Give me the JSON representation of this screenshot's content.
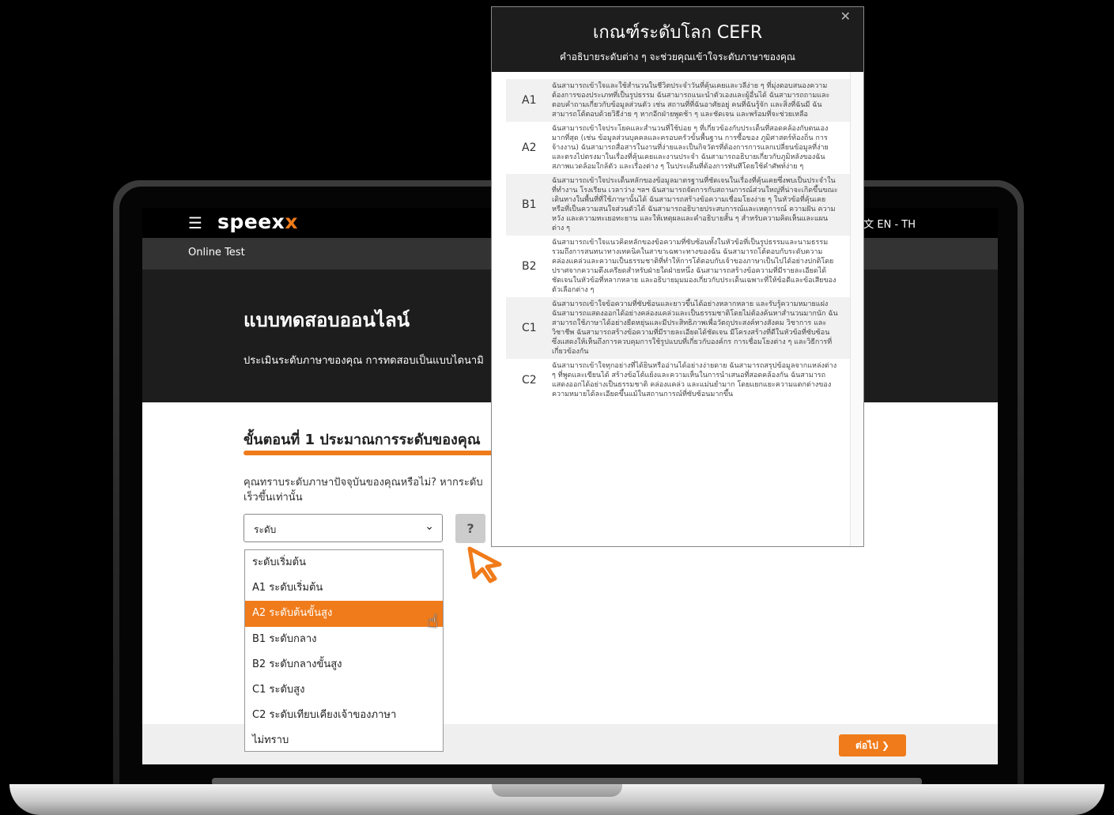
{
  "app": {
    "logo_main": "speex",
    "logo_accent": "x",
    "language": "EN - TH",
    "menu_icon": "hamburger-icon",
    "breadcrumb": "Online Test"
  },
  "hero": {
    "title": "แบบทดสอบออนไลน์",
    "subtitle": "ประเมินระดับภาษาของคุณ การทดสอบเป็นแบบไดนามิ"
  },
  "step": {
    "title": "ขั้นตอนที่ 1 ประมาณการระดับของคุณ",
    "question": "คุณทราบระดับภาษาปัจจุบันของคุณหรือไม่? หากระดับ เร็วขึ้นเท่านั้น"
  },
  "level_select": {
    "value": "ระดับ",
    "help_label": "?",
    "options": [
      "ระดับเริ่มต้น",
      "A1 ระดับเริ่มต้น",
      "A2 ระดับต้นขั้นสูง",
      "B1 ระดับกลาง",
      "B2 ระดับกลางขั้นสูง",
      "C1 ระดับสูง",
      "C2 ระดับเทียบเคียงเจ้าของภาษา",
      "ไม่ทราบ"
    ],
    "highlighted_index": 2
  },
  "footer": {
    "next_label": "ต่อไป ❯"
  },
  "cefr_modal": {
    "title": "เกณฑ์ระดับโลก CEFR",
    "subtitle": "คำอธิบายระดับต่าง ๆ จะช่วยคุณเข้าใจระดับภาษาของคุณ",
    "close_label": "✕",
    "levels": [
      {
        "code": "A1",
        "desc": "ฉันสามารถเข้าใจและใช้สำนวนในชีวิตประจำวันที่คุ้นเคยและวลีง่าย ๆ ที่มุ่งตอบสนองความต้องการของประเภทที่เป็นรูปธรรม ฉันสามารถแนะนำตัวเองและผู้อื่นได้ ฉันสามารถถามและตอบคำถามเกี่ยวกับข้อมูลส่วนตัว เช่น สถานที่ที่ฉันอาศัยอยู่ คนที่ฉันรู้จัก และสิ่งที่ฉันมี ฉันสามารถโต้ตอบด้วยวิธีง่าย ๆ หากอีกฝ่ายพูดช้า ๆ และชัดเจน และพร้อมที่จะช่วยเหลือ"
      },
      {
        "code": "A2",
        "desc": "ฉันสามารถเข้าใจประโยคและสำนวนที่ใช้บ่อย ๆ ที่เกี่ยวข้องกับประเด็นที่สอดคล้องกับตนเองมากที่สุด (เช่น ข้อมูลส่วนบุคคลและครอบครัวขั้นพื้นฐาน การซื้อของ ภูมิศาสตร์ท้องถิ่น การจ้างงาน) ฉันสามารถสื่อสารในงานที่ง่ายและเป็นกิจวัตรที่ต้องการการแลกเปลี่ยนข้อมูลที่ง่ายและตรงไปตรงมาในเรื่องที่คุ้นเคยและงานประจำ ฉันสามารถอธิบายเกี่ยวกับภูมิหลังของฉัน สภาพแวดล้อมใกล้ตัว และเรื่องต่าง ๆ ในประเด็นที่ต้องการทันทีโดยใช้คำศัพท์ง่าย ๆ"
      },
      {
        "code": "B1",
        "desc": "ฉันสามารถเข้าใจประเด็นหลักของข้อมูลมาตรฐานที่ชัดเจนในเรื่องที่คุ้นเคยซึ่งพบเป็นประจำในที่ทำงาน โรงเรียน เวลาว่าง ฯลฯ ฉันสามารถจัดการกับสถานการณ์ส่วนใหญ่ที่น่าจะเกิดขึ้นขณะเดินทางในพื้นที่ที่ใช้ภาษานั้นได้ ฉันสามารถสร้างข้อความเชื่อมโยงง่าย ๆ ในหัวข้อที่คุ้นเคยหรือที่เป็นความสนใจส่วนตัวได้ ฉันสามารถอธิบายประสบการณ์และเหตุการณ์ ความฝัน ความหวัง และความทะเยอทะยาน และให้เหตุผลและคำอธิบายสั้น ๆ สำหรับความคิดเห็นและแผนต่าง ๆ"
      },
      {
        "code": "B2",
        "desc": "ฉันสามารถเข้าใจแนวคิดหลักของข้อความที่ซับซ้อนทั้งในหัวข้อที่เป็นรูปธรรมและนามธรรม รวมถึงการสนทนาทางเทคนิคในสาขาเฉพาะทางของฉัน ฉันสามารถโต้ตอบกับระดับความคล่องแคล่วและความเป็นธรรมชาติที่ทำให้การโต้ตอบกับเจ้าของภาษาเป็นไปได้อย่างปกติโดยปราศจากความตึงเครียดสำหรับฝ่ายใดฝ่ายหนึ่ง ฉันสามารถสร้างข้อความที่มีรายละเอียดได้ชัดเจนในหัวข้อที่หลากหลาย และอธิบายมุมมองเกี่ยวกับประเด็นเฉพาะที่ให้ข้อดีและข้อเสียของตัวเลือกต่าง ๆ"
      },
      {
        "code": "C1",
        "desc": "ฉันสามารถเข้าใจข้อความที่ซับซ้อนและยาวขึ้นได้อย่างหลากหลาย และรับรู้ความหมายแฝง ฉันสามารถแสดงออกได้อย่างคล่องแคล่วและเป็นธรรมชาติโดยไม่ต้องค้นหาสำนวนมากนัก ฉันสามารถใช้ภาษาได้อย่างยืดหยุ่นและมีประสิทธิภาพเพื่อวัตถุประสงค์ทางสังคม วิชาการ และวิชาชีพ ฉันสามารถสร้างข้อความที่มีรายละเอียดได้ชัดเจน มีโครงสร้างที่ดีในหัวข้อที่ซับซ้อน ซึ่งแสดงให้เห็นถึงการควบคุมการใช้รูปแบบที่เกี่ยวกับองค์กร การเชื่อมโยงต่าง ๆ และวิธีการที่เกี่ยวข้องกัน"
      },
      {
        "code": "C2",
        "desc": "ฉันสามารถเข้าใจทุกอย่างที่ได้ยินหรืออ่านได้อย่างง่ายดาย ฉันสามารถสรุปข้อมูลจากแหล่งต่าง ๆ ที่พูดและเขียนได้ สร้างข้อโต้แย้งและความเห็นในการนำเสนอที่สอดคล้องกัน ฉันสามารถแสดงออกได้อย่างเป็นธรรมชาติ คล่องแคล่ว และแม่นยำมาก โดยแยกแยะความแตกต่างของความหมายได้ละเอียดขึ้นแม้ในสถานการณ์ที่ซับซ้อนมากขึ้น"
      }
    ]
  }
}
